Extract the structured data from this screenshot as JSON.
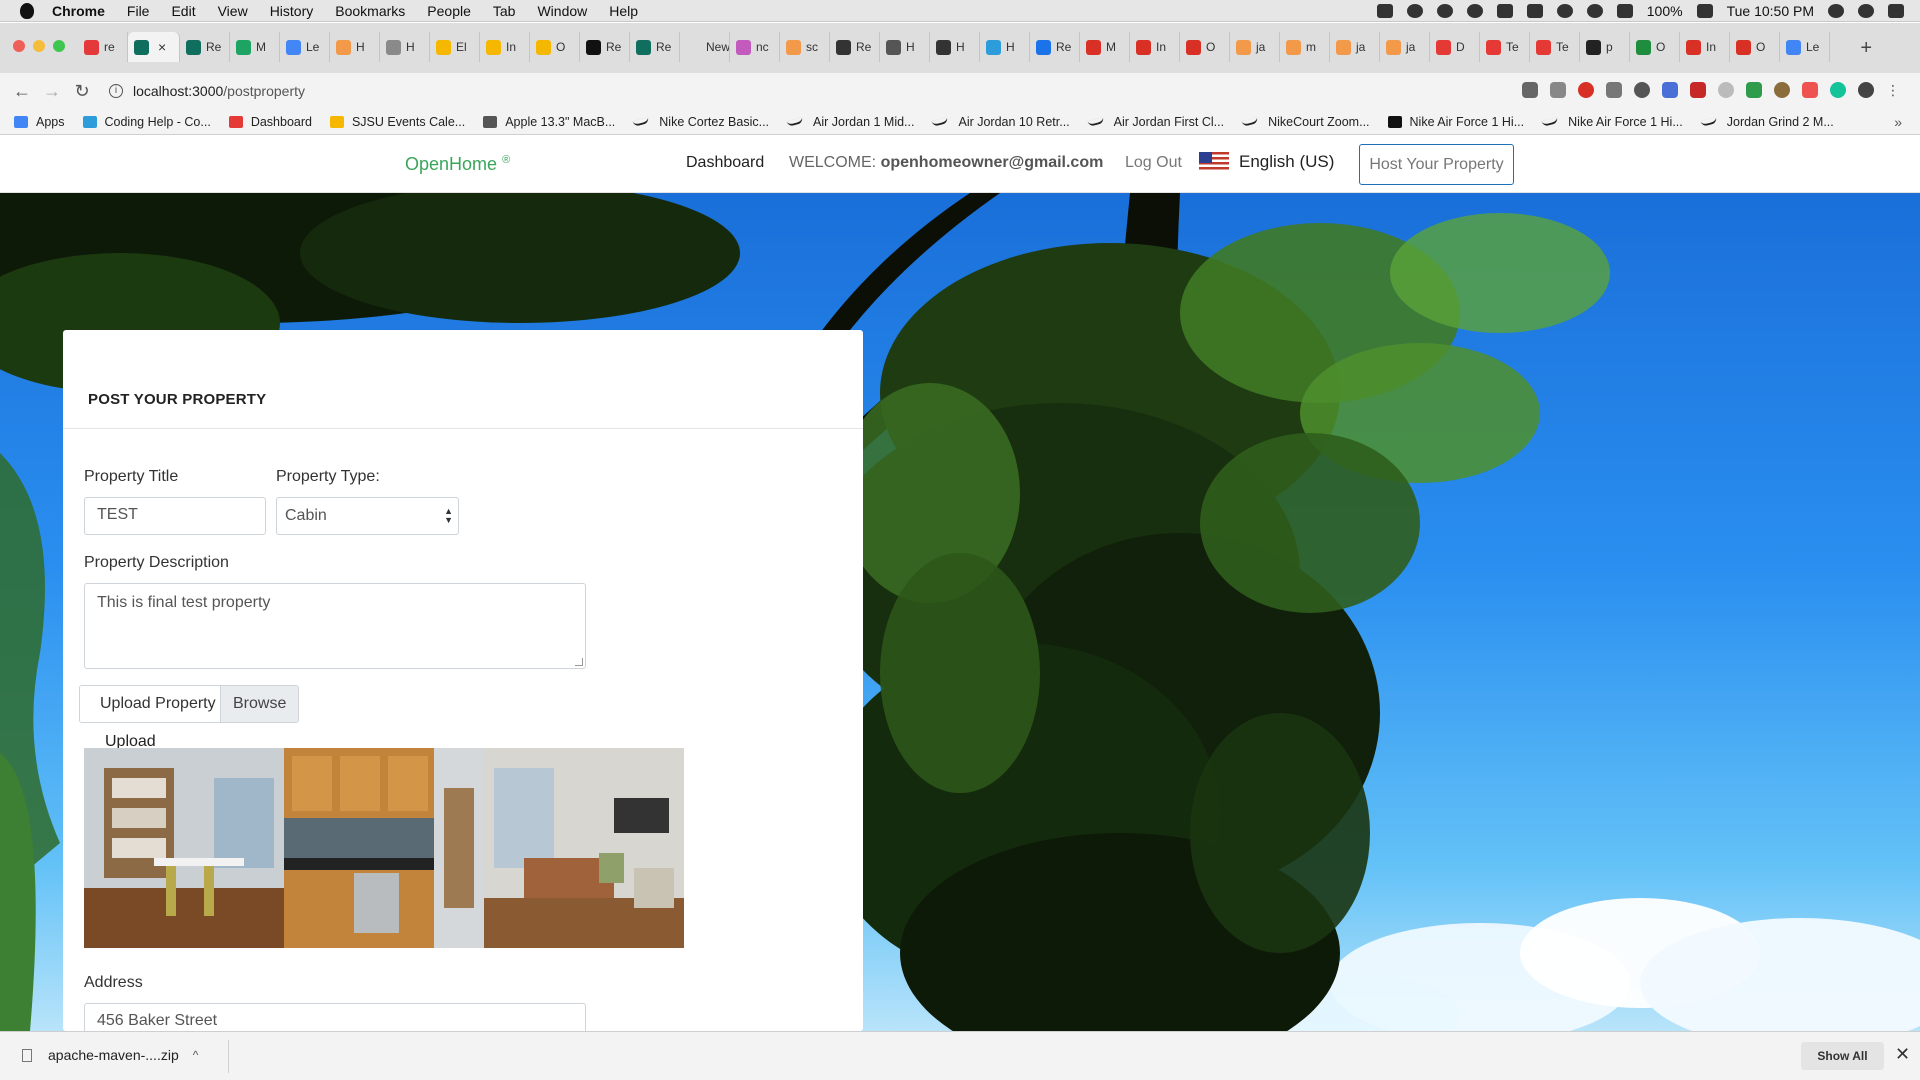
{
  "menubar": {
    "app": "Chrome",
    "items": [
      "File",
      "Edit",
      "View",
      "History",
      "Bookmarks",
      "People",
      "Tab",
      "Window",
      "Help"
    ],
    "battery": "100%",
    "clock": "Tue 10:50 PM"
  },
  "tabs": [
    {
      "label": "re",
      "color": "#e5383b"
    },
    {
      "label": "",
      "color": "#0f6e5d",
      "active": true
    },
    {
      "label": "Re",
      "color": "#0f6e5d"
    },
    {
      "label": "M",
      "color": "#1da462"
    },
    {
      "label": "Le",
      "color": "#4285f4"
    },
    {
      "label": "H",
      "color": "#f2994a"
    },
    {
      "label": "H",
      "color": "#8a8a8a"
    },
    {
      "label": "El",
      "color": "#f5b700"
    },
    {
      "label": "In",
      "color": "#f5b700"
    },
    {
      "label": "O",
      "color": "#f5b700"
    },
    {
      "label": "Re",
      "color": "#111111"
    },
    {
      "label": "Re",
      "color": "#0f6e5d"
    },
    {
      "label": "New T",
      "color": "#dedede"
    },
    {
      "label": "nc",
      "color": "#c25bbd"
    },
    {
      "label": "sc",
      "color": "#f2994a"
    },
    {
      "label": "Re",
      "color": "#333333"
    },
    {
      "label": "H",
      "color": "#555555"
    },
    {
      "label": "H",
      "color": "#333333"
    },
    {
      "label": "H",
      "color": "#2d9cdb"
    },
    {
      "label": "Re",
      "color": "#1a73e8"
    },
    {
      "label": "M",
      "color": "#d93025"
    },
    {
      "label": "In",
      "color": "#d93025"
    },
    {
      "label": "O",
      "color": "#d93025"
    },
    {
      "label": "ja",
      "color": "#f2994a"
    },
    {
      "label": "m",
      "color": "#f2994a"
    },
    {
      "label": "ja",
      "color": "#f2994a"
    },
    {
      "label": "ja",
      "color": "#f2994a"
    },
    {
      "label": "D",
      "color": "#e53935"
    },
    {
      "label": "Te",
      "color": "#e53935"
    },
    {
      "label": "Te",
      "color": "#e53935"
    },
    {
      "label": "p",
      "color": "#222222"
    },
    {
      "label": "O",
      "color": "#1e8e3e"
    },
    {
      "label": "In",
      "color": "#d93025"
    },
    {
      "label": "O",
      "color": "#d93025"
    },
    {
      "label": "Le",
      "color": "#4285f4"
    }
  ],
  "address": {
    "host": "localhost:3000",
    "path": "/postproperty"
  },
  "bookmarks": {
    "items": [
      {
        "label": "Apps",
        "color": "#4285f4",
        "kind": "icon"
      },
      {
        "label": "Coding Help - Co...",
        "color": "#2d9cdb",
        "kind": "icon"
      },
      {
        "label": "Dashboard",
        "color": "#e53935",
        "kind": "icon"
      },
      {
        "label": "SJSU Events Cale...",
        "color": "#f5b700",
        "kind": "icon"
      },
      {
        "label": "Apple 13.3\" MacB...",
        "color": "#555555",
        "kind": "icon"
      },
      {
        "label": "Nike Cortez Basic...",
        "kind": "swoosh"
      },
      {
        "label": "Air Jordan 1 Mid...",
        "kind": "swoosh"
      },
      {
        "label": "Air Jordan 10 Retr...",
        "kind": "swoosh"
      },
      {
        "label": "Air Jordan First Cl...",
        "kind": "swoosh"
      },
      {
        "label": "NikeCourt Zoom...",
        "kind": "swoosh"
      },
      {
        "label": "Nike Air Force 1 Hi...",
        "color": "#111111",
        "kind": "icon"
      },
      {
        "label": "Nike Air Force 1 Hi...",
        "kind": "swoosh"
      },
      {
        "label": "Jordan Grind 2 M...",
        "kind": "swoosh"
      }
    ]
  },
  "sitenav": {
    "brand": "OpenHome",
    "brand_mark": "®",
    "dashboard": "Dashboard",
    "welcome_prefix": "WELCOME:",
    "user_email": "openhomeowner@gmail.com",
    "logout": "Log Out",
    "language": "English (US)",
    "host_button": "Host Your Property"
  },
  "form": {
    "title": "POST YOUR PROPERTY",
    "property_title_label": "Property Title",
    "property_title_value": "TEST",
    "property_type_label": "Property Type:",
    "property_type_value": "Cabin",
    "description_label": "Property Description",
    "description_value": "This is final test property",
    "upload_label": "Upload Property",
    "browse_label": "Browse",
    "upload_text": "Upload",
    "address_label": "Address",
    "address_value": "456 Baker Street"
  },
  "downloads": {
    "file": "apache-maven-....zip",
    "show_all": "Show All"
  }
}
